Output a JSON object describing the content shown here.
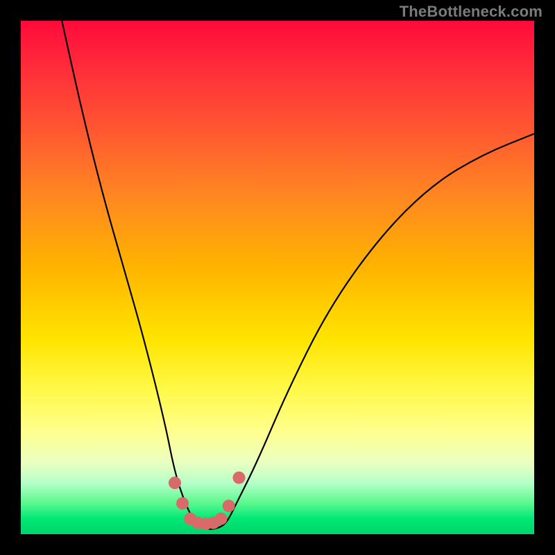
{
  "watermark": "TheBottleneck.com",
  "chart_data": {
    "type": "line",
    "title": "",
    "xlabel": "",
    "ylabel": "",
    "xlim": [
      0,
      100
    ],
    "ylim": [
      0,
      100
    ],
    "series": [
      {
        "name": "bottleneck-curve",
        "x": [
          8,
          12,
          16,
          20,
          24,
          28,
          30,
          32,
          34,
          36,
          38,
          40,
          42,
          46,
          52,
          60,
          70,
          80,
          90,
          100
        ],
        "y": [
          100,
          82,
          66,
          52,
          38,
          22,
          12,
          6,
          2,
          1,
          1,
          2,
          6,
          14,
          28,
          44,
          58,
          68,
          74,
          78
        ]
      }
    ],
    "markers": {
      "name": "highlight-dots",
      "color": "#d86a6a",
      "x": [
        30.0,
        31.5,
        33.0,
        34.5,
        36.0,
        37.5,
        39.0,
        40.5,
        42.5
      ],
      "y": [
        10.0,
        6.0,
        3.0,
        2.2,
        2.0,
        2.2,
        3.0,
        5.5,
        11.0
      ]
    },
    "background_gradient": {
      "top": "#ff0a3a",
      "upper_mid": "#ffb400",
      "mid": "#fff94a",
      "lower_mid": "#b6ffc8",
      "bottom": "#00d46a"
    }
  }
}
